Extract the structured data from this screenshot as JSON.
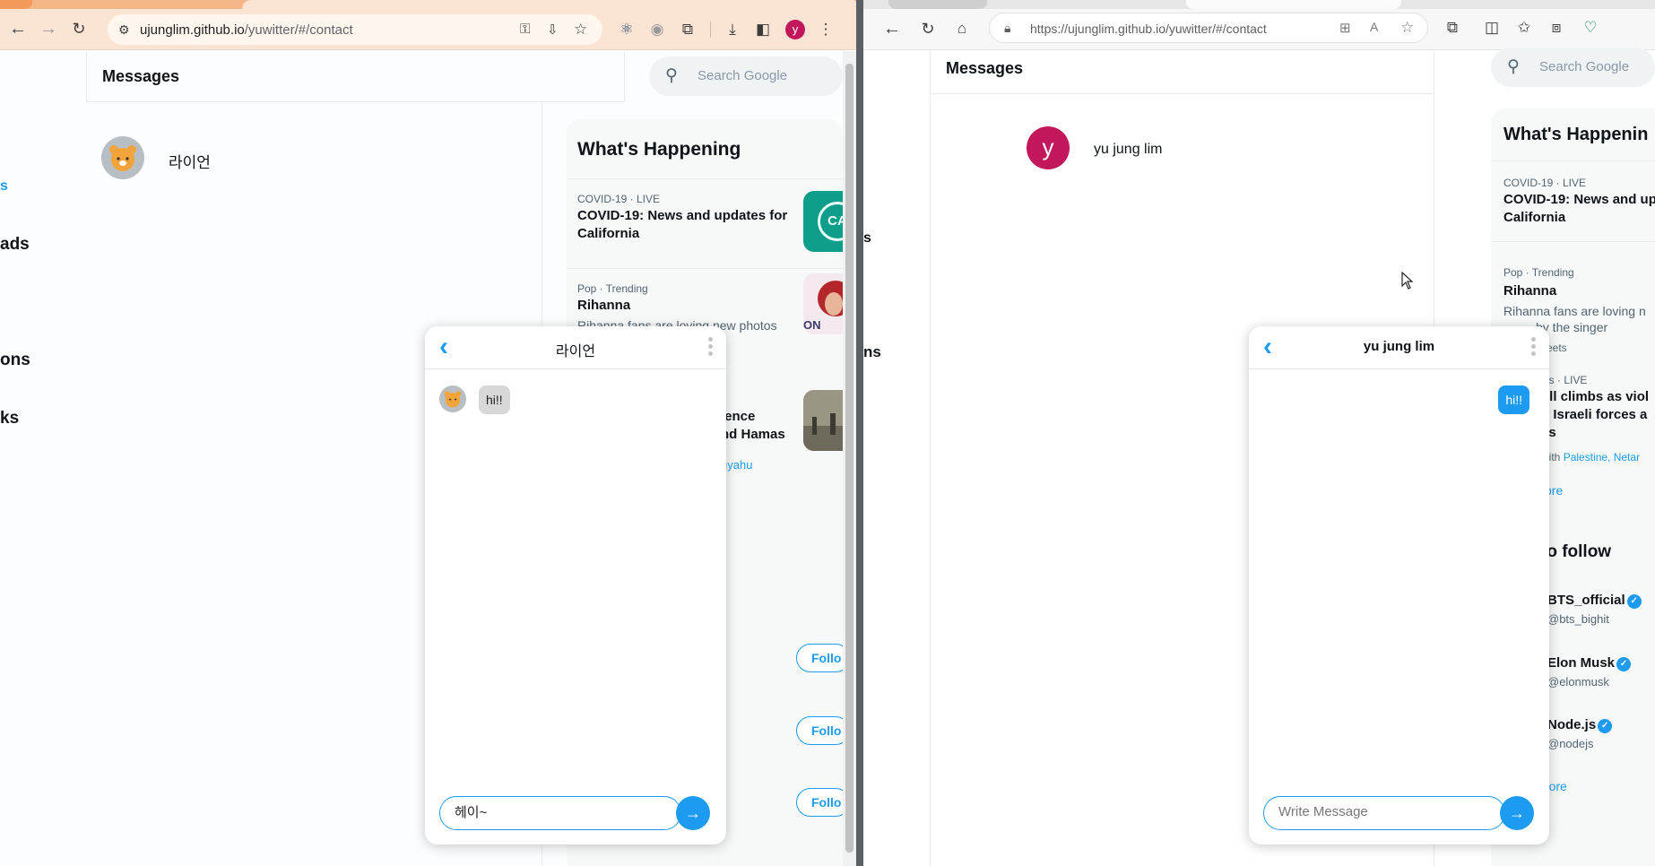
{
  "left_browser": {
    "url_host": "ujunglim.github.io",
    "url_path": "/yuwitter/#/contact",
    "profile_initial": "y"
  },
  "right_browser": {
    "url": "https://ujunglim.github.io/yuwitter/#/contact"
  },
  "left_app": {
    "sidebar_fragments": [
      "s",
      "ads",
      "ons",
      "ks"
    ],
    "header_title": "Messages",
    "search_placeholder": "Search Google",
    "contacts": [
      {
        "name": "라이언"
      }
    ],
    "trends_title": "What's Happening",
    "trends": [
      {
        "meta": "COVID-19 · LIVE",
        "title": "COVID-19: News and updates for California",
        "thumb_text": "CA"
      },
      {
        "meta": "Pop · Trending",
        "title": "Rihanna",
        "subtitle": "Rihanna fans are loving new photos",
        "thumb_text": "ON"
      },
      {
        "title_line1": "lence",
        "title_line2": "nd Hamas",
        "link": "nyahu"
      }
    ],
    "follow_label": "Follo"
  },
  "left_chat": {
    "title": "라이언",
    "messages": [
      {
        "text": "hi!!",
        "direction": "received"
      }
    ],
    "input_value": "헤이~",
    "send_icon": "→"
  },
  "right_app": {
    "header_title": "Messages",
    "search_placeholder": "Search Google",
    "contacts": [
      {
        "name": "yu jung lim",
        "initial": "y"
      }
    ],
    "sidebar_fragments": [
      "s",
      "ns"
    ],
    "trends_title": "What's Happenin",
    "trends": [
      {
        "meta": "COVID-19 · LIVE",
        "title": "COVID-19: News and up",
        "title2": "California"
      },
      {
        "meta": "Pop · Trending",
        "title": "Rihanna",
        "subtitle": "Rihanna fans are loving n",
        "subtitle2": "by the singer",
        "extra": "veets"
      },
      {
        "meta": "ws · LIVE",
        "title": "oll climbs as viol",
        "title2": "n Israeli forces a",
        "title3": "es",
        "with_prefix": "with",
        "with_links": "Palestine, Netar"
      }
    ],
    "show_more_partial": "ore",
    "follow_title": "to follow",
    "follow": [
      {
        "name": "BTS_official",
        "handle": "@bts_bighit"
      },
      {
        "name": "Elon Musk",
        "handle": "@elonmusk"
      },
      {
        "name": "Node.js",
        "handle": "@nodejs"
      }
    ],
    "show_more": "Show more"
  },
  "right_chat": {
    "title": "yu jung lim",
    "messages": [
      {
        "text": "hi!!",
        "direction": "sent"
      }
    ],
    "input_placeholder": "Write Message",
    "send_icon": "→"
  },
  "colors": {
    "accent": "#1d9bf0",
    "avatar_y": "#c2185b",
    "chrome_bar": "#fbe4d3"
  }
}
